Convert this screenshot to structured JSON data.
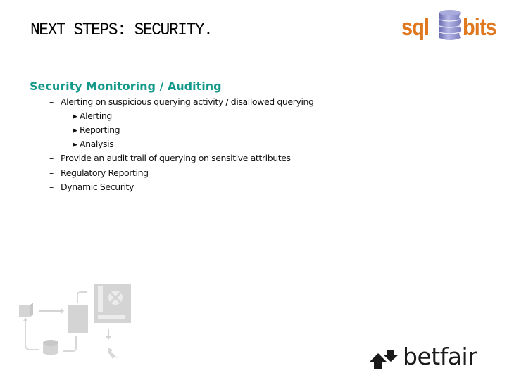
{
  "slide": {
    "title": "NEXT STEPS: SECURITY.",
    "heading": "Security Monitoring / Auditing",
    "bullets": [
      {
        "level": 1,
        "marker": "dash",
        "text": "Alerting on suspicious querying activity / disallowed querying"
      },
      {
        "level": 2,
        "marker": "triangle",
        "text": "Alerting"
      },
      {
        "level": 2,
        "marker": "triangle",
        "text": "Reporting"
      },
      {
        "level": 2,
        "marker": "triangle",
        "text": "Analysis"
      },
      {
        "level": 1,
        "marker": "dash",
        "text": "Provide an audit trail of querying on sensitive attributes"
      },
      {
        "level": 1,
        "marker": "dash",
        "text": "Regulatory Reporting"
      },
      {
        "level": 1,
        "marker": "dash",
        "text": "Dynamic Security"
      }
    ],
    "markers": {
      "dash": "–",
      "triangle": "▶"
    }
  },
  "logos": {
    "sqlbits": {
      "left_text": "sql",
      "right_text": "bits",
      "text_color": "#e07820",
      "cylinder_color": "#8e90cc"
    },
    "betfair": {
      "text": "betfair",
      "color": "#1a1a1a"
    }
  },
  "colors": {
    "heading": "#15998a",
    "diagram": "#d4d4d4"
  }
}
